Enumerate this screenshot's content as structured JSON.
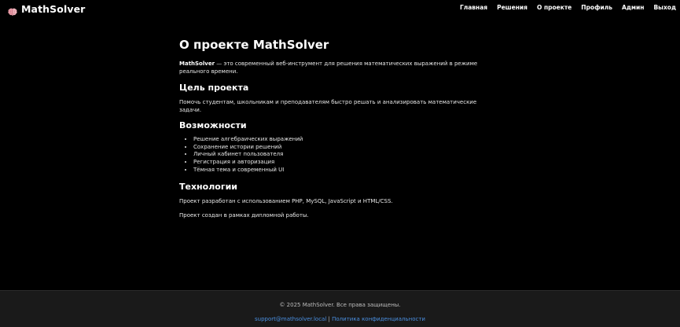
{
  "header": {
    "brand": "MathSolver",
    "brand_icon": "brain-icon",
    "nav": [
      "Главная",
      "Решения",
      "О проекте",
      "Профиль",
      "Админ",
      "Выход"
    ]
  },
  "main": {
    "title": "О проекте MathSolver",
    "intro_strong": "MathSolver",
    "intro_rest": " — это современный веб-инструмент для решения математических выражений в режиме реального времени.",
    "goal": {
      "heading": "Цель проекта",
      "text": "Помочь студентам, школьникам и преподавателям быстро решать и анализировать математические задачи."
    },
    "features": {
      "heading": "Возможности",
      "items": [
        "Решение алгебраических выражений",
        "Сохранение истории решений",
        "Личный кабинет пользователя",
        "Регистрация и авторизация",
        "Тёмная тема и современный UI"
      ]
    },
    "tech": {
      "heading": "Технологии",
      "text": "Проект разработан с использованием PHP, MySQL, JavaScript и HTML/CSS.",
      "note": "Проект создан в рамках дипломной работы."
    }
  },
  "footer": {
    "copyright": "© 2025 MathSolver. Все права защищены.",
    "email": "support@mathsolver.local",
    "separator": "|",
    "privacy": "Политика конфиденциальности"
  },
  "colors": {
    "background": "#000000",
    "footer_bg": "#1a1a1a",
    "link": "#4a8fe0",
    "brand_icon": "#e89aa6"
  }
}
